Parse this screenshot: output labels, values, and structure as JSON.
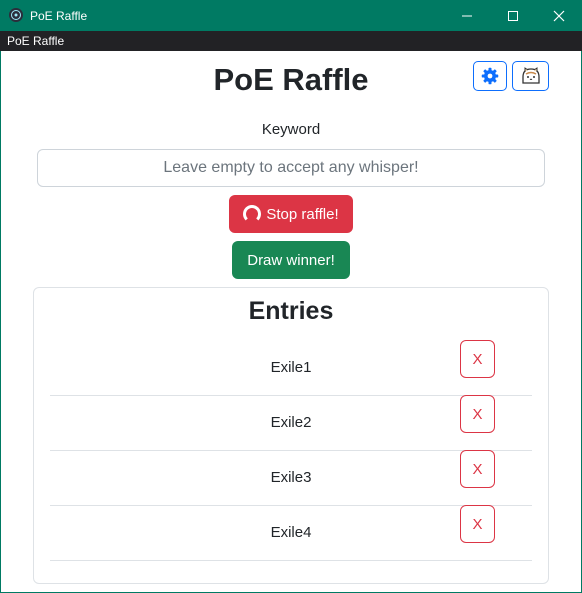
{
  "window": {
    "title": "PoE Raffle",
    "menu": [
      "PoE Raffle"
    ]
  },
  "header": {
    "title": "PoE Raffle",
    "settings_icon": "gear-icon",
    "theme_icon": "cat-icon"
  },
  "keyword": {
    "label": "Keyword",
    "value": "",
    "placeholder": "Leave empty to accept any whisper!"
  },
  "actions": {
    "stop_label": "Stop raffle!",
    "draw_label": "Draw winner!"
  },
  "entries": {
    "title": "Entries",
    "remove_label": "X",
    "items": [
      "Exile1",
      "Exile2",
      "Exile3",
      "Exile4"
    ]
  },
  "colors": {
    "titlebar": "#007a63",
    "primary": "#0d6efd",
    "danger": "#dc3545",
    "success": "#198754"
  }
}
